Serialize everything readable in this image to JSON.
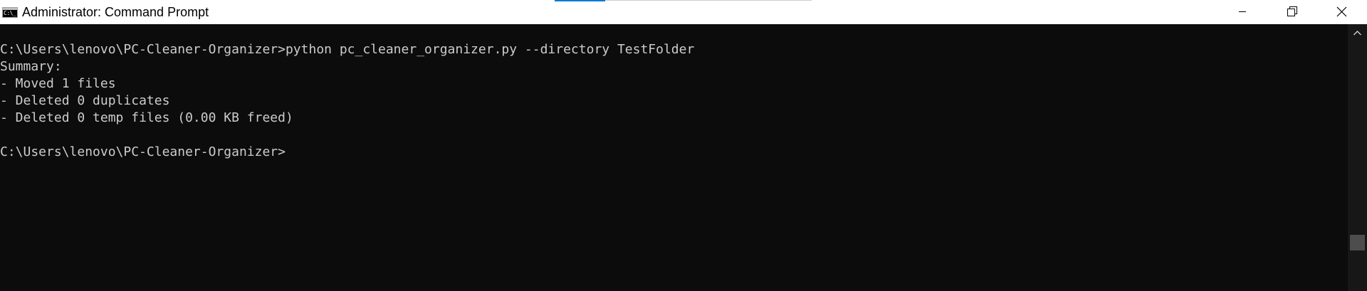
{
  "window": {
    "title": "Administrator: Command Prompt",
    "app_icon_text": "C:\\_"
  },
  "controls": {
    "minimize": "minimize-icon",
    "restore": "restore-icon",
    "close": "close-icon"
  },
  "console": {
    "lines": [
      "C:\\Users\\lenovo\\PC-Cleaner-Organizer>python pc_cleaner_organizer.py --directory TestFolder",
      "Summary:",
      "- Moved 1 files",
      "- Deleted 0 duplicates",
      "- Deleted 0 temp files (0.00 KB freed)",
      "",
      "C:\\Users\\lenovo\\PC-Cleaner-Organizer>"
    ]
  },
  "colors": {
    "console_bg": "#0c0c0c",
    "console_text": "#cccccc",
    "titlebar_bg": "#ffffff",
    "accent": "#0078d7"
  },
  "scrollbar": {
    "up_arrow": "chevron-up-icon"
  }
}
